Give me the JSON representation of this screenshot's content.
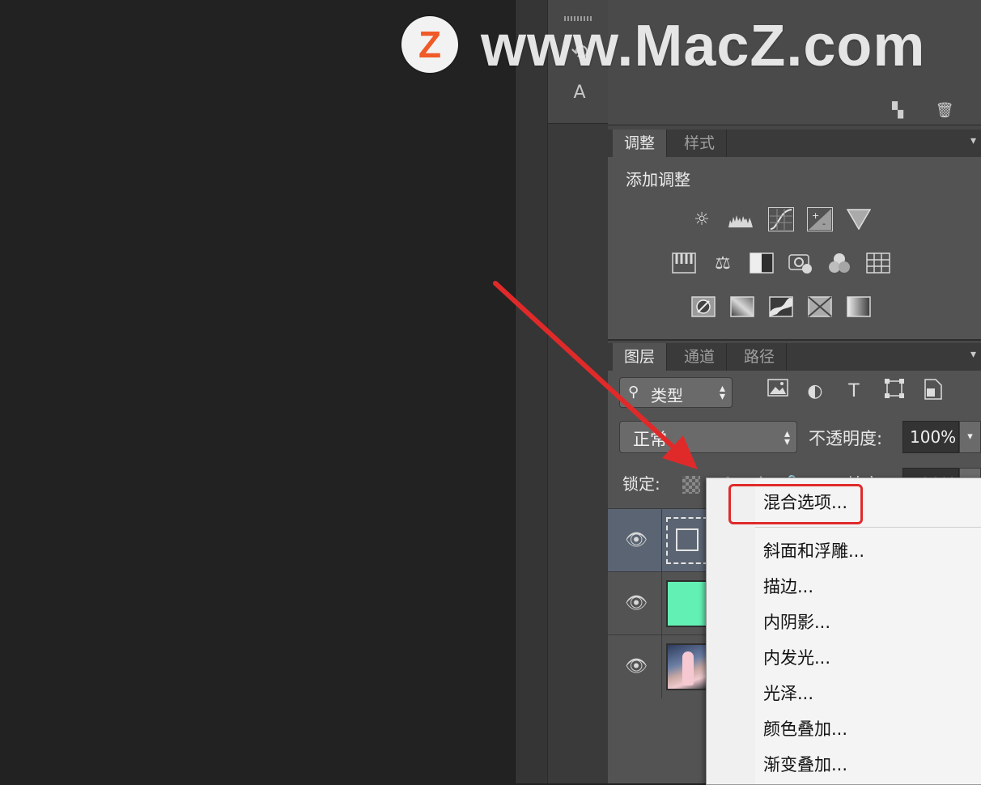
{
  "watermark": {
    "logo_letter": "Z",
    "text": "www.MacZ.com"
  },
  "toolstrip": {
    "char_tool": "A"
  },
  "adjustments_panel": {
    "tabs": [
      {
        "label": "调整",
        "active": true
      },
      {
        "label": "样式",
        "active": false
      }
    ],
    "title": "添加调整",
    "icon_rows": [
      [
        "brightness-contrast-icon",
        "levels-icon",
        "curves-icon",
        "exposure-icon",
        "vibrance-icon"
      ],
      [
        "hue-saturation-icon",
        "color-balance-icon",
        "black-white-icon",
        "photo-filter-icon",
        "channel-mixer-icon",
        "color-lookup-icon"
      ],
      [
        "invert-icon",
        "posterize-icon",
        "threshold-icon",
        "selective-color-icon",
        "gradient-map-icon"
      ]
    ]
  },
  "layers_panel": {
    "tabs": [
      {
        "label": "图层",
        "active": true
      },
      {
        "label": "通道",
        "active": false
      },
      {
        "label": "路径",
        "active": false
      }
    ],
    "filter": {
      "label": "类型"
    },
    "blend_mode": {
      "value": "正常"
    },
    "opacity": {
      "label": "不透明度:",
      "value": "100%"
    },
    "lock": {
      "label": "锁定:"
    },
    "fill": {
      "label": "填充:",
      "value": "100%"
    },
    "layers": [
      {
        "thumb": "shape",
        "selected": true
      },
      {
        "thumb": "green",
        "selected": false
      },
      {
        "thumb": "photo",
        "selected": false
      }
    ]
  },
  "context_menu": {
    "items": [
      "混合选项...",
      "斜面和浮雕...",
      "描边...",
      "内阴影...",
      "内发光...",
      "光泽...",
      "颜色叠加...",
      "渐变叠加..."
    ],
    "highlighted_index": 0
  },
  "colors": {
    "annotation_red": "#e02a2a",
    "canvas_bg": "#222222",
    "panel_bg": "#535353",
    "logo_orange": "#f05a28"
  }
}
